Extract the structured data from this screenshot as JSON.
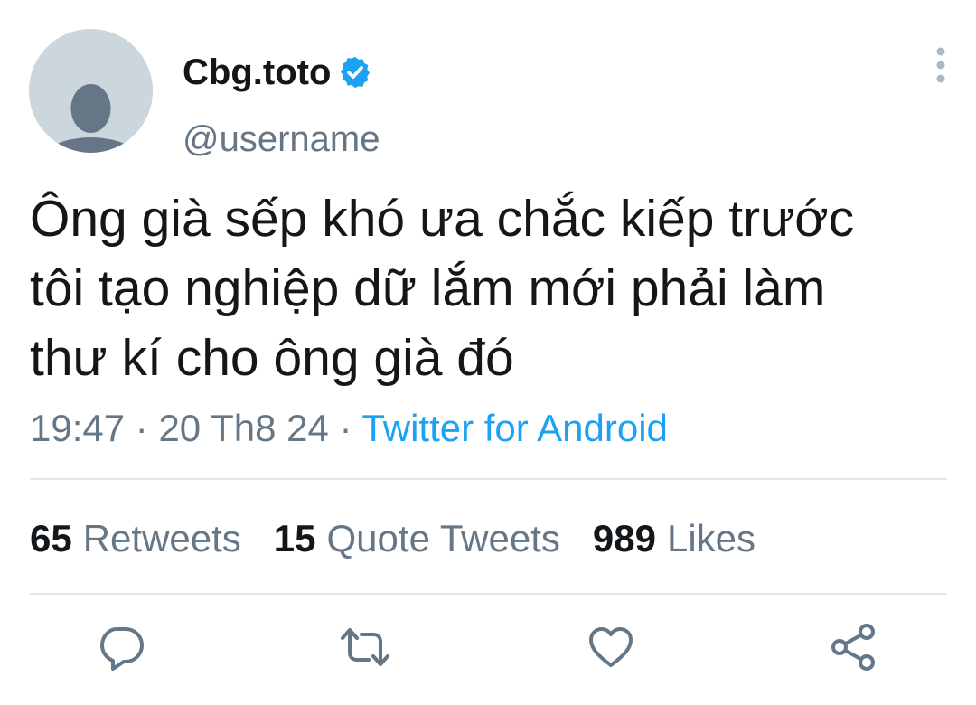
{
  "author": {
    "display_name": "Cbg.toto",
    "handle": "@username",
    "verified": true,
    "avatar_icon": "default-avatar-icon",
    "verified_icon": "verified-badge-icon"
  },
  "menu": {
    "icon": "more-vertical-icon"
  },
  "tweet": {
    "text": "Ông già sếp khó ưa chắc kiếp trước\ntôi tạo nghiệp dữ lắm mới phải làm\nthư kí cho ông già đó",
    "time": "19:47",
    "date": "20 Th8 24",
    "separator": " · ",
    "source": "Twitter for Android"
  },
  "stats": {
    "retweets": {
      "count": "65",
      "label": "Retweets"
    },
    "quotes": {
      "count": "15",
      "label": "Quote Tweets"
    },
    "likes": {
      "count": "989",
      "label": "Likes"
    }
  },
  "actions": [
    {
      "icon": "reply-icon"
    },
    {
      "icon": "retweet-icon"
    },
    {
      "icon": "like-icon"
    },
    {
      "icon": "share-icon"
    }
  ],
  "colors": {
    "primary_text": "#14171a",
    "secondary_text": "#657786",
    "accent": "#1da1f2",
    "divider": "#e1e8ed",
    "avatar_bg": "#ccd6dd"
  }
}
